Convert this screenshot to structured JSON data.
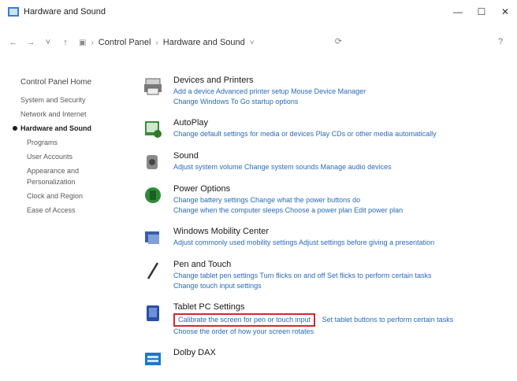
{
  "window": {
    "title": "Hardware and Sound",
    "controls": [
      "—",
      "☐",
      "✕"
    ]
  },
  "address": {
    "crumbs": [
      "Control Panel",
      "Hardware and Sound"
    ],
    "refresh": "⟳",
    "help": "?"
  },
  "sidebar": {
    "home": "Control Panel Home",
    "items": [
      "System and Security",
      "Network and Internet",
      "Hardware and Sound",
      "Programs",
      "User Accounts",
      "Appearance and Personalization",
      "Clock and Region",
      "Ease of Access"
    ],
    "active_index": 2
  },
  "categories": [
    {
      "title": "Devices and Printers",
      "links_line1": "Add a device    Advanced printer setup    Mouse    Device Manager",
      "links_line2": "Change Windows To Go startup options"
    },
    {
      "title": "AutoPlay",
      "links_line1": "Change default settings for media or devices    Play CDs or other media automatically"
    },
    {
      "title": "Sound",
      "links_line1": "Adjust system volume    Change system sounds    Manage audio devices"
    },
    {
      "title": "Power Options",
      "links_line1": "Change battery settings    Change what the power buttons do",
      "links_line2": "Change when the computer sleeps    Choose a power plan    Edit power plan"
    },
    {
      "title": "Windows Mobility Center",
      "links_line1": "Adjust commonly used mobility settings    Adjust settings before giving a presentation"
    },
    {
      "title": "Pen and Touch",
      "links_line1": "Change tablet pen settings    Turn flicks on and off    Set flicks to perform certain tasks",
      "links_line2": "Change touch input settings"
    },
    {
      "title": "Tablet PC Settings",
      "highlight_link": "Calibrate the screen for pen or touch input",
      "links_rest": "Set tablet buttons to perform certain tasks",
      "links_line2": "Choose the order of how your screen rotates"
    },
    {
      "title": "Dolby DAX"
    }
  ]
}
